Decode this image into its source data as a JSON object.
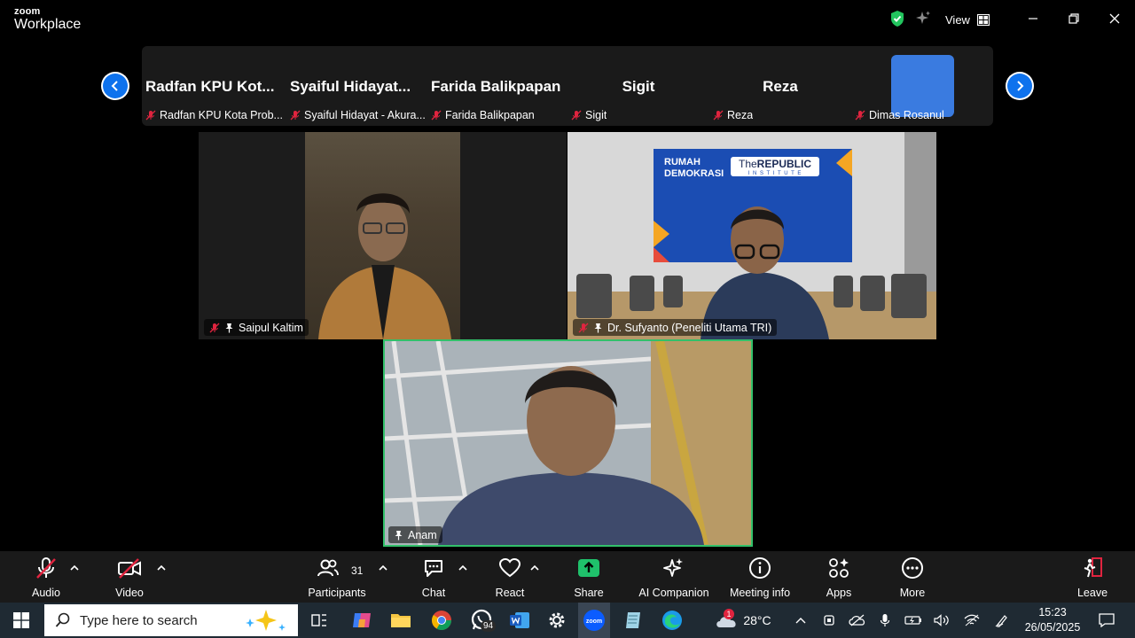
{
  "app": {
    "brand_top": "zoom",
    "brand_bottom": "Workplace",
    "view_label": "View"
  },
  "strip": {
    "tiles": [
      {
        "big": "Radfan  KPU  Kot...",
        "tag": "Radfan KPU Kota Prob..."
      },
      {
        "big": "Syaiful  Hidayat...",
        "tag": "Syaiful Hidayat - Akura..."
      },
      {
        "big": "Farida Balikpapan",
        "tag": "Farida Balikpapan"
      },
      {
        "big": "Sigit",
        "tag": "Sigit"
      },
      {
        "big": "Reza",
        "tag": "Reza"
      },
      {
        "big": "",
        "tag": "Dimas Rosanul"
      }
    ]
  },
  "videos": {
    "saipul": "Saipul Kaltim",
    "sufyanto": "Dr. Sufyanto (Peneliti Utama TRI)",
    "anam": "Anam",
    "banner_line1": "RUMAH",
    "banner_line2": "DEMOKRASI",
    "banner_logo_the": "The",
    "banner_logo_name": "REPUBLIC",
    "banner_logo_sub": "I N S T I T U T E"
  },
  "toolbar": {
    "audio": "Audio",
    "video": "Video",
    "participants": "Participants",
    "participants_count": "31",
    "chat": "Chat",
    "react": "React",
    "share": "Share",
    "ai": "AI Companion",
    "info": "Meeting info",
    "apps": "Apps",
    "more": "More",
    "leave": "Leave"
  },
  "taskbar": {
    "search_placeholder": "Type here to search",
    "whatsapp_badge": "94",
    "weather_badge": "1",
    "temperature": "28°C",
    "time": "15:23",
    "date": "26/05/2025"
  },
  "colors": {
    "accent_blue": "#0e72ed",
    "active_speaker": "#32c06a",
    "share_green": "#1fc16b",
    "muted_red": "#e0243f",
    "leave_red": "#e0243f"
  }
}
